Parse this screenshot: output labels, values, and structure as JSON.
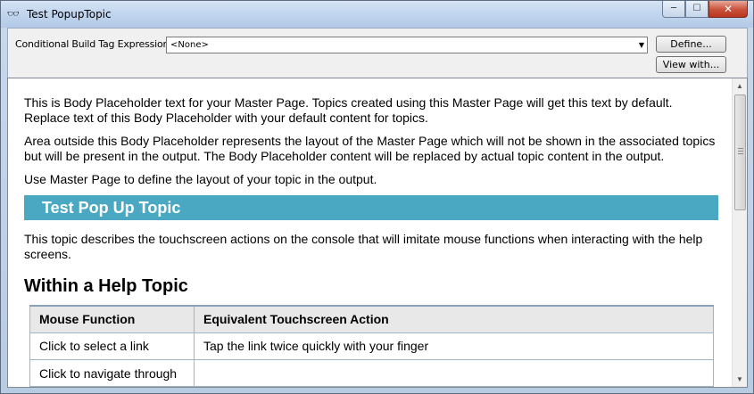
{
  "window": {
    "title": "Test PopupTopic",
    "icon": "glasses-icon",
    "controls": {
      "minimize": "─",
      "maximize": "☐",
      "close": "✕"
    }
  },
  "toolbar": {
    "cbt_label": "Conditional Build Tag Expression:",
    "cbt_value": "<None>",
    "define_label": "Define...",
    "view_label": "View with..."
  },
  "doc": {
    "para1": "This is Body Placeholder text for your Master Page. Topics created using this Master Page will get this text by default. Replace text of this Body Placeholder with your default content for topics.",
    "para2": "Area outside this Body Placeholder represents the layout of the Master Page which will not be shown in the associated topics but will be present in the output. The Body Placeholder content will be replaced by actual topic content in the output.",
    "para3": "Use Master Page to define the layout of your topic in the output.",
    "topic_title": "Test Pop Up Topic",
    "intro": "This topic describes the touchscreen actions on the console that will imitate mouse functions when interacting with the help screens.",
    "section_heading": "Within a Help Topic",
    "table": {
      "headers": [
        "Mouse Function",
        "Equivalent Touchscreen Action"
      ],
      "rows": [
        [
          "Click to select a link",
          "Tap the link twice quickly with your finger"
        ],
        [
          "Click to navigate through",
          ""
        ]
      ]
    }
  },
  "colors": {
    "topic_bar": "#4ba8c2",
    "title_gradient_top": "#d6e4f5",
    "close_button": "#c9503a"
  }
}
